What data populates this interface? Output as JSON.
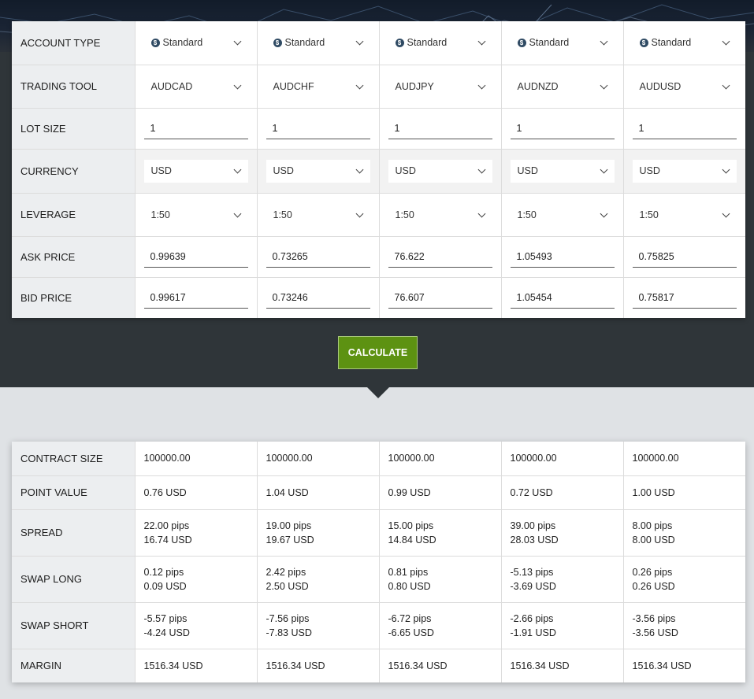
{
  "labels": {
    "account_type": "ACCOUNT TYPE",
    "trading_tool": "TRADING TOOL",
    "lot_size": "LOT SIZE",
    "currency": "CURRENCY",
    "leverage": "LEVERAGE",
    "ask_price": "ASK PRICE",
    "bid_price": "BID PRICE"
  },
  "columns": [
    {
      "account_type": "Standard",
      "trading_tool": "AUDCAD",
      "lot_size": "1",
      "currency": "USD",
      "leverage": "1:50",
      "ask_price": "0.99639",
      "bid_price": "0.99617"
    },
    {
      "account_type": "Standard",
      "trading_tool": "AUDCHF",
      "lot_size": "1",
      "currency": "USD",
      "leverage": "1:50",
      "ask_price": "0.73265",
      "bid_price": "0.73246"
    },
    {
      "account_type": "Standard",
      "trading_tool": "AUDJPY",
      "lot_size": "1",
      "currency": "USD",
      "leverage": "1:50",
      "ask_price": "76.622",
      "bid_price": "76.607"
    },
    {
      "account_type": "Standard",
      "trading_tool": "AUDNZD",
      "lot_size": "1",
      "currency": "USD",
      "leverage": "1:50",
      "ask_price": "1.05493",
      "bid_price": "1.05454"
    },
    {
      "account_type": "Standard",
      "trading_tool": "AUDUSD",
      "lot_size": "1",
      "currency": "USD",
      "leverage": "1:50",
      "ask_price": "0.75825",
      "bid_price": "0.75817"
    }
  ],
  "calculate_label": "CALCULATE",
  "result_labels": {
    "contract_size": "CONTRACT SIZE",
    "point_value": "POINT VALUE",
    "spread": "SPREAD",
    "swap_long": "SWAP LONG",
    "swap_short": "SWAP SHORT",
    "margin": "MARGIN"
  },
  "results": [
    {
      "contract_size": "100000.00",
      "point_value": "0.76 USD",
      "spread_pips": "22.00 pips",
      "spread_usd": "16.74 USD",
      "swap_long_pips": "0.12 pips",
      "swap_long_usd": "0.09 USD",
      "swap_short_pips": "-5.57 pips",
      "swap_short_usd": "-4.24 USD",
      "margin": "1516.34 USD"
    },
    {
      "contract_size": "100000.00",
      "point_value": "1.04 USD",
      "spread_pips": "19.00 pips",
      "spread_usd": "19.67 USD",
      "swap_long_pips": "2.42 pips",
      "swap_long_usd": "2.50 USD",
      "swap_short_pips": "-7.56 pips",
      "swap_short_usd": "-7.83 USD",
      "margin": "1516.34 USD"
    },
    {
      "contract_size": "100000.00",
      "point_value": "0.99 USD",
      "spread_pips": "15.00 pips",
      "spread_usd": "14.84 USD",
      "swap_long_pips": "0.81 pips",
      "swap_long_usd": "0.80 USD",
      "swap_short_pips": "-6.72 pips",
      "swap_short_usd": "-6.65 USD",
      "margin": "1516.34 USD"
    },
    {
      "contract_size": "100000.00",
      "point_value": "0.72 USD",
      "spread_pips": "39.00 pips",
      "spread_usd": "28.03 USD",
      "swap_long_pips": "-5.13 pips",
      "swap_long_usd": "-3.69 USD",
      "swap_short_pips": "-2.66 pips",
      "swap_short_usd": "-1.91 USD",
      "margin": "1516.34 USD"
    },
    {
      "contract_size": "100000.00",
      "point_value": "1.00 USD",
      "spread_pips": "8.00 pips",
      "spread_usd": "8.00 USD",
      "swap_long_pips": "0.26 pips",
      "swap_long_usd": "0.26 USD",
      "swap_short_pips": "-3.56 pips",
      "swap_short_usd": "-3.56 USD",
      "margin": "1516.34 USD"
    }
  ],
  "colors": {
    "button_green": "#5d9212",
    "dark_panel": "#2f3539",
    "label_bg": "#eceef0",
    "page_bg": "#dfe2e5"
  }
}
